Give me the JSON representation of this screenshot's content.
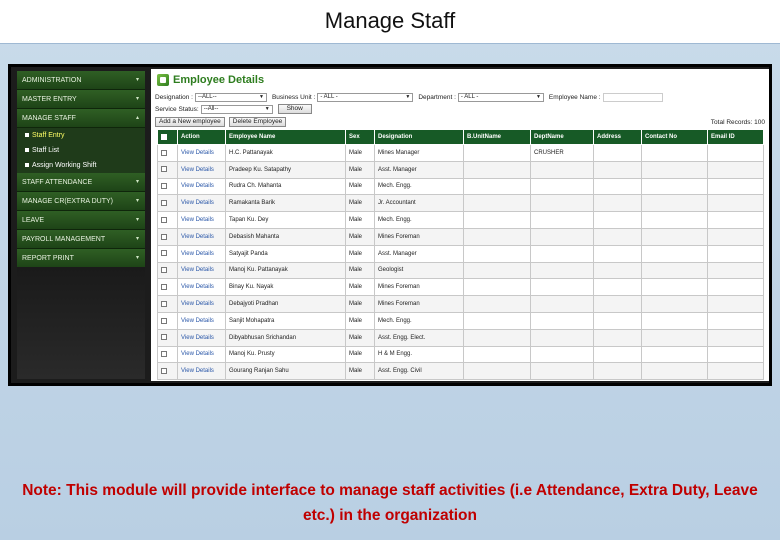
{
  "slide_title": "Manage Staff",
  "sidebar": {
    "items": [
      {
        "label": "ADMINISTRATION",
        "caret": "▾"
      },
      {
        "label": "MASTER ENTRY",
        "caret": "▾"
      },
      {
        "label": "MANAGE STAFF",
        "caret": "▴"
      }
    ],
    "subitems": [
      {
        "label": "Staff Entry"
      },
      {
        "label": "Staff List"
      },
      {
        "label": "Assign Working Shift"
      }
    ],
    "items_after": [
      {
        "label": "STAFF ATTENDANCE",
        "caret": "▾"
      },
      {
        "label": "MANAGE CR(Extra DUTY)",
        "caret": "▾"
      },
      {
        "label": "Leave",
        "caret": "▾"
      },
      {
        "label": "Payroll Management",
        "caret": "▾"
      },
      {
        "label": "REPORT PRINT",
        "caret": "▾"
      }
    ]
  },
  "panel": {
    "title": "Employee Details",
    "filters": {
      "designation_label": "Designation :",
      "designation_value": "--ALL--",
      "business_unit_label": "Business Unit :",
      "business_unit_value": "- ALL -",
      "department_label": "Department :",
      "department_value": "- ALL -",
      "employee_name_label": "Employee Name :",
      "service_status_label": "Service Status:",
      "service_status_value": "--All--",
      "show_button": "Show"
    },
    "add_button": "Add a New employee",
    "delete_button": "Delete Employee",
    "total_records": "Total Records: 100"
  },
  "table": {
    "headers": [
      "",
      "Action",
      "Employee Name",
      "Sex",
      "Designation",
      "B.UnitName",
      "DeptName",
      "Address",
      "Contact No",
      "Email ID"
    ],
    "rows": [
      {
        "action": "View Details",
        "name": "H.C. Pattanayak",
        "sex": "Male",
        "designation": "Mines Manager",
        "bunit": "",
        "dept": "CRUSHER",
        "address": "",
        "contact": "",
        "email": ""
      },
      {
        "action": "View Details",
        "name": "Pradeep Ku. Satapathy",
        "sex": "Male",
        "designation": "Asst. Manager",
        "bunit": "",
        "dept": "",
        "address": "",
        "contact": "",
        "email": ""
      },
      {
        "action": "View Details",
        "name": "Rudra Ch. Mahanta",
        "sex": "Male",
        "designation": "Mech. Engg.",
        "bunit": "",
        "dept": "",
        "address": "",
        "contact": "",
        "email": ""
      },
      {
        "action": "View Details",
        "name": "Ramakanta Barik",
        "sex": "Male",
        "designation": "Jr. Accountant",
        "bunit": "",
        "dept": "",
        "address": "",
        "contact": "",
        "email": ""
      },
      {
        "action": "View Details",
        "name": "Tapan Ku. Dey",
        "sex": "Male",
        "designation": "Mech. Engg.",
        "bunit": "",
        "dept": "",
        "address": "",
        "contact": "",
        "email": ""
      },
      {
        "action": "View Details",
        "name": "Debasish Mahanta",
        "sex": "Male",
        "designation": "Mines Foreman",
        "bunit": "",
        "dept": "",
        "address": "",
        "contact": "",
        "email": ""
      },
      {
        "action": "View Details",
        "name": "Satyajit Panda",
        "sex": "Male",
        "designation": "Asst. Manager",
        "bunit": "",
        "dept": "",
        "address": "",
        "contact": "",
        "email": ""
      },
      {
        "action": "View Details",
        "name": "Manoj Ku. Pattanayak",
        "sex": "Male",
        "designation": "Geologist",
        "bunit": "",
        "dept": "",
        "address": "",
        "contact": "",
        "email": ""
      },
      {
        "action": "View Details",
        "name": "Binay Ku. Nayak",
        "sex": "Male",
        "designation": "Mines Foreman",
        "bunit": "",
        "dept": "",
        "address": "",
        "contact": "",
        "email": ""
      },
      {
        "action": "View Details",
        "name": "Debajyoti Pradhan",
        "sex": "Male",
        "designation": "Mines Foreman",
        "bunit": "",
        "dept": "",
        "address": "",
        "contact": "",
        "email": ""
      },
      {
        "action": "View Details",
        "name": "Sanjit Mohapatra",
        "sex": "Male",
        "designation": "Mech. Engg.",
        "bunit": "",
        "dept": "",
        "address": "",
        "contact": "",
        "email": ""
      },
      {
        "action": "View Details",
        "name": "Dibyabhusan Srichandan",
        "sex": "Male",
        "designation": "Asst. Engg. Elect.",
        "bunit": "",
        "dept": "",
        "address": "",
        "contact": "",
        "email": ""
      },
      {
        "action": "View Details",
        "name": "Manoj Ku. Prusty",
        "sex": "Male",
        "designation": "H & M Engg.",
        "bunit": "",
        "dept": "",
        "address": "",
        "contact": "",
        "email": ""
      },
      {
        "action": "View Details",
        "name": "Gourang Ranjan Sahu",
        "sex": "Male",
        "designation": "Asst. Engg. Civil",
        "bunit": "",
        "dept": "",
        "address": "",
        "contact": "",
        "email": ""
      }
    ]
  },
  "note": "Note: This module will provide interface to manage staff activities (i.e Attendance, Extra Duty, Leave etc.) in the organization"
}
